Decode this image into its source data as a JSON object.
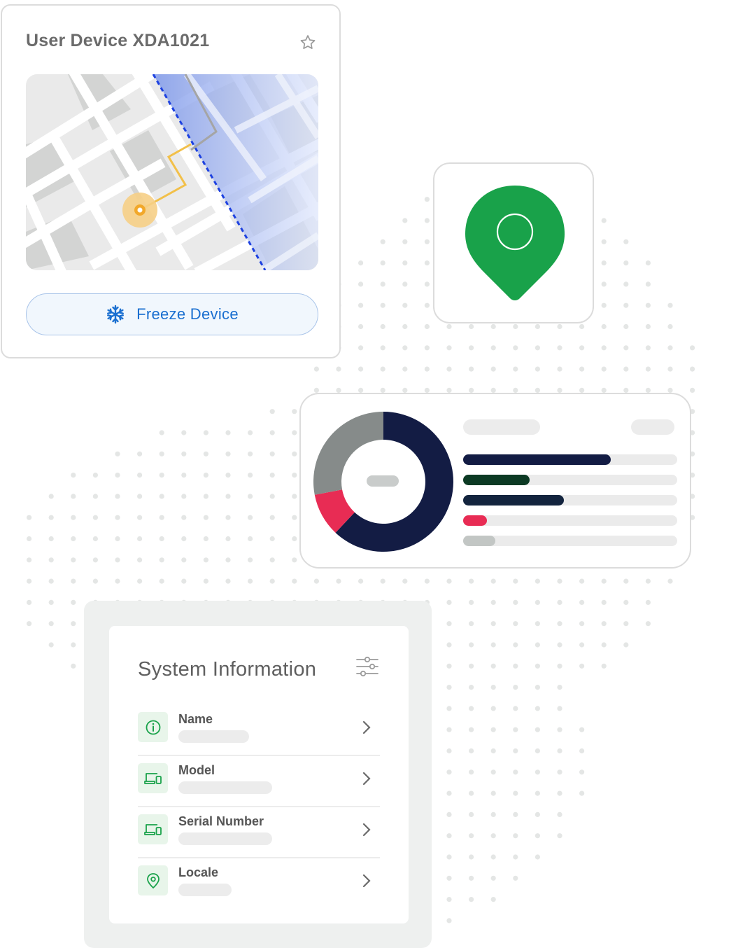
{
  "device_card": {
    "title": "User Device XDA1021",
    "freeze_label": "Freeze Device",
    "icons": {
      "favorite": "star-outline-icon",
      "freeze": "snowflake-icon"
    }
  },
  "pin_card": {
    "icon": "location-pin-icon",
    "color": "#19a24a"
  },
  "chart_data": {
    "type": "pie",
    "variant": "donut",
    "labels_visible": false,
    "slices": [
      {
        "value": 62,
        "color": "#131c44"
      },
      {
        "value": 10,
        "color": "#e82c54"
      },
      {
        "value": 28,
        "color": "#868b8a"
      }
    ],
    "bars": [
      {
        "value": 0.69,
        "color": "#131c44"
      },
      {
        "value": 0.31,
        "color": "#0c3a24"
      },
      {
        "value": 0.47,
        "color": "#13243e"
      },
      {
        "value": 0.11,
        "color": "#e82c54"
      },
      {
        "value": 0.15,
        "color": "#c2c6c4"
      }
    ]
  },
  "system_info": {
    "title": "System Information",
    "icon": "filter-sliders-icon",
    "rows": [
      {
        "label": "Name",
        "icon": "info-icon"
      },
      {
        "label": "Model",
        "icon": "devices-icon"
      },
      {
        "label": "Serial Number",
        "icon": "devices-icon"
      },
      {
        "label": "Locale",
        "icon": "location-pin-icon"
      }
    ]
  },
  "colors": {
    "accent_blue": "#1a6fd0",
    "accent_green": "#19a24a",
    "route_yellow": "#f2c04a"
  }
}
